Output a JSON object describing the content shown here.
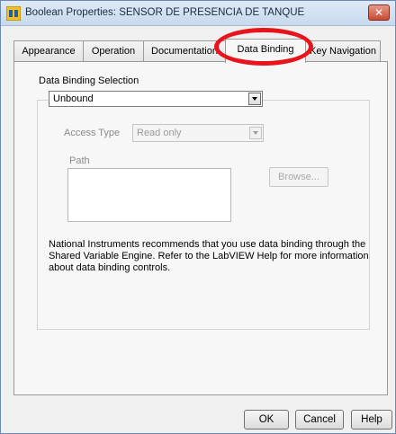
{
  "window": {
    "title": "Boolean Properties: SENSOR DE PRESENCIA DE TANQUE",
    "close_label": "✕"
  },
  "tabs": [
    {
      "label": "Appearance"
    },
    {
      "label": "Operation"
    },
    {
      "label": "Documentation"
    },
    {
      "label": "Data Binding",
      "active": true
    },
    {
      "label": "Key Navigation"
    }
  ],
  "data_binding": {
    "selection_label": "Data Binding Selection",
    "selection_value": "Unbound",
    "access_type_label": "Access Type",
    "access_type_value": "Read only",
    "path_label": "Path",
    "path_value": "",
    "browse_label": "Browse...",
    "info_lines": [
      "National Instruments recommends that you use data binding through the",
      "Shared Variable Engine.  Refer to the LabVIEW Help for more information",
      "about data binding controls."
    ]
  },
  "buttons": {
    "ok": "OK",
    "cancel": "Cancel",
    "help": "Help"
  },
  "colors": {
    "annotation_ring": "#e8141b",
    "close_button": "#c94a34"
  }
}
